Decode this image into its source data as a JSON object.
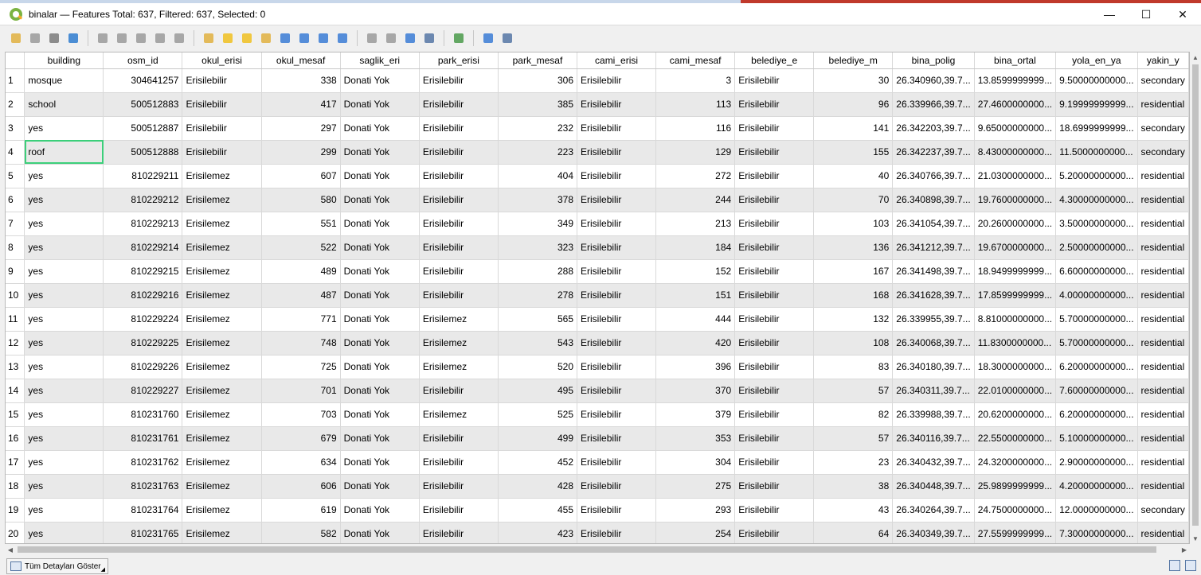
{
  "window": {
    "title": "binalar — Features Total: 637, Filtered: 637, Selected: 0",
    "minimize": "—",
    "maximize": "☐",
    "close": "✕"
  },
  "toolbar": [
    {
      "name": "toggle-editing-icon"
    },
    {
      "name": "multi-edit-icon"
    },
    {
      "name": "save-edits-icon"
    },
    {
      "name": "reload-table-icon"
    },
    {
      "sep": true
    },
    {
      "name": "add-feature-icon"
    },
    {
      "name": "delete-feature-icon"
    },
    {
      "name": "cut-icon"
    },
    {
      "name": "copy-icon"
    },
    {
      "name": "paste-icon"
    },
    {
      "sep": true
    },
    {
      "name": "select-by-expression-icon"
    },
    {
      "name": "select-all-icon"
    },
    {
      "name": "invert-selection-icon"
    },
    {
      "name": "deselect-all-icon"
    },
    {
      "name": "filter-select-icon"
    },
    {
      "name": "move-selected-to-top-icon"
    },
    {
      "name": "pan-map-to-selected-icon"
    },
    {
      "name": "zoom-map-to-selected-icon"
    },
    {
      "sep": true
    },
    {
      "name": "new-field-icon"
    },
    {
      "name": "delete-field-icon"
    },
    {
      "name": "field-calculator-icon"
    },
    {
      "name": "conditional-formatting-icon"
    },
    {
      "sep": true
    },
    {
      "name": "organize-columns-icon"
    },
    {
      "sep": true
    },
    {
      "name": "dock-table-icon"
    },
    {
      "name": "actions-icon"
    }
  ],
  "table": {
    "columns": [
      "building",
      "osm_id",
      "okul_erisi",
      "okul_mesaf",
      "saglik_eri",
      "park_erisi",
      "park_mesaf",
      "cami_erisi",
      "cami_mesaf",
      "belediye_e",
      "belediye_m",
      "bina_polig",
      "bina_ortal",
      "yola_en_ya",
      "yakin_y"
    ],
    "numeric_columns": [
      1,
      3,
      6,
      8,
      10
    ],
    "rows": [
      [
        "1",
        "mosque",
        "304641257",
        "Erisilebilir",
        "338",
        "Donati Yok",
        "Erisilebilir",
        "306",
        "Erisilebilir",
        "3",
        "Erisilebilir",
        "30",
        "26.340960,39.7...",
        "13.8599999999...",
        "9.50000000000...",
        "secondary"
      ],
      [
        "2",
        "school",
        "500512883",
        "Erisilebilir",
        "417",
        "Donati Yok",
        "Erisilebilir",
        "385",
        "Erisilebilir",
        "113",
        "Erisilebilir",
        "96",
        "26.339966,39.7...",
        "27.4600000000...",
        "9.19999999999...",
        "residential"
      ],
      [
        "3",
        "yes",
        "500512887",
        "Erisilebilir",
        "297",
        "Donati Yok",
        "Erisilebilir",
        "232",
        "Erisilebilir",
        "116",
        "Erisilebilir",
        "141",
        "26.342203,39.7...",
        "9.65000000000...",
        "18.6999999999...",
        "secondary"
      ],
      [
        "4",
        "roof",
        "500512888",
        "Erisilebilir",
        "299",
        "Donati Yok",
        "Erisilebilir",
        "223",
        "Erisilebilir",
        "129",
        "Erisilebilir",
        "155",
        "26.342237,39.7...",
        "8.43000000000...",
        "11.5000000000...",
        "secondary"
      ],
      [
        "5",
        "yes",
        "810229211",
        "Erisilemez",
        "607",
        "Donati Yok",
        "Erisilebilir",
        "404",
        "Erisilebilir",
        "272",
        "Erisilebilir",
        "40",
        "26.340766,39.7...",
        "21.0300000000...",
        "5.20000000000...",
        "residential"
      ],
      [
        "6",
        "yes",
        "810229212",
        "Erisilemez",
        "580",
        "Donati Yok",
        "Erisilebilir",
        "378",
        "Erisilebilir",
        "244",
        "Erisilebilir",
        "70",
        "26.340898,39.7...",
        "19.7600000000...",
        "4.30000000000...",
        "residential"
      ],
      [
        "7",
        "yes",
        "810229213",
        "Erisilemez",
        "551",
        "Donati Yok",
        "Erisilebilir",
        "349",
        "Erisilebilir",
        "213",
        "Erisilebilir",
        "103",
        "26.341054,39.7...",
        "20.2600000000...",
        "3.50000000000...",
        "residential"
      ],
      [
        "8",
        "yes",
        "810229214",
        "Erisilemez",
        "522",
        "Donati Yok",
        "Erisilebilir",
        "323",
        "Erisilebilir",
        "184",
        "Erisilebilir",
        "136",
        "26.341212,39.7...",
        "19.6700000000...",
        "2.50000000000...",
        "residential"
      ],
      [
        "9",
        "yes",
        "810229215",
        "Erisilemez",
        "489",
        "Donati Yok",
        "Erisilebilir",
        "288",
        "Erisilebilir",
        "152",
        "Erisilebilir",
        "167",
        "26.341498,39.7...",
        "18.9499999999...",
        "6.60000000000...",
        "residential"
      ],
      [
        "10",
        "yes",
        "810229216",
        "Erisilemez",
        "487",
        "Donati Yok",
        "Erisilebilir",
        "278",
        "Erisilebilir",
        "151",
        "Erisilebilir",
        "168",
        "26.341628,39.7...",
        "17.8599999999...",
        "4.00000000000...",
        "residential"
      ],
      [
        "11",
        "yes",
        "810229224",
        "Erisilemez",
        "771",
        "Donati Yok",
        "Erisilemez",
        "565",
        "Erisilebilir",
        "444",
        "Erisilebilir",
        "132",
        "26.339955,39.7...",
        "8.81000000000...",
        "5.70000000000...",
        "residential"
      ],
      [
        "12",
        "yes",
        "810229225",
        "Erisilemez",
        "748",
        "Donati Yok",
        "Erisilemez",
        "543",
        "Erisilebilir",
        "420",
        "Erisilebilir",
        "108",
        "26.340068,39.7...",
        "11.8300000000...",
        "5.70000000000...",
        "residential"
      ],
      [
        "13",
        "yes",
        "810229226",
        "Erisilemez",
        "725",
        "Donati Yok",
        "Erisilemez",
        "520",
        "Erisilebilir",
        "396",
        "Erisilebilir",
        "83",
        "26.340180,39.7...",
        "18.3000000000...",
        "6.20000000000...",
        "residential"
      ],
      [
        "14",
        "yes",
        "810229227",
        "Erisilemez",
        "701",
        "Donati Yok",
        "Erisilebilir",
        "495",
        "Erisilebilir",
        "370",
        "Erisilebilir",
        "57",
        "26.340311,39.7...",
        "22.0100000000...",
        "7.60000000000...",
        "residential"
      ],
      [
        "15",
        "yes",
        "810231760",
        "Erisilemez",
        "703",
        "Donati Yok",
        "Erisilemez",
        "525",
        "Erisilebilir",
        "379",
        "Erisilebilir",
        "82",
        "26.339988,39.7...",
        "20.6200000000...",
        "6.20000000000...",
        "residential"
      ],
      [
        "16",
        "yes",
        "810231761",
        "Erisilemez",
        "679",
        "Donati Yok",
        "Erisilebilir",
        "499",
        "Erisilebilir",
        "353",
        "Erisilebilir",
        "57",
        "26.340116,39.7...",
        "22.5500000000...",
        "5.10000000000...",
        "residential"
      ],
      [
        "17",
        "yes",
        "810231762",
        "Erisilemez",
        "634",
        "Donati Yok",
        "Erisilebilir",
        "452",
        "Erisilebilir",
        "304",
        "Erisilebilir",
        "23",
        "26.340432,39.7...",
        "24.3200000000...",
        "2.90000000000...",
        "residential"
      ],
      [
        "18",
        "yes",
        "810231763",
        "Erisilemez",
        "606",
        "Donati Yok",
        "Erisilebilir",
        "428",
        "Erisilebilir",
        "275",
        "Erisilebilir",
        "38",
        "26.340448,39.7...",
        "25.9899999999...",
        "4.20000000000...",
        "residential"
      ],
      [
        "19",
        "yes",
        "810231764",
        "Erisilemez",
        "619",
        "Donati Yok",
        "Erisilebilir",
        "455",
        "Erisilebilir",
        "293",
        "Erisilebilir",
        "43",
        "26.340264,39.7...",
        "24.7500000000...",
        "12.0000000000...",
        "secondary"
      ],
      [
        "20",
        "yes",
        "810231765",
        "Erisilemez",
        "582",
        "Donati Yok",
        "Erisilebilir",
        "423",
        "Erisilebilir",
        "254",
        "Erisilebilir",
        "64",
        "26.340349,39.7...",
        "27.5599999999...",
        "7.30000000000...",
        "residential"
      ]
    ],
    "current_cell": {
      "row": 4,
      "column": "building"
    }
  },
  "statusbar": {
    "show_all_features_label": "Tüm Detayları Göster"
  },
  "colors": {
    "alt_row": "#e9e9e9",
    "current_cell_outline": "#3ccf7a",
    "qgis_green": "#7cb342"
  }
}
